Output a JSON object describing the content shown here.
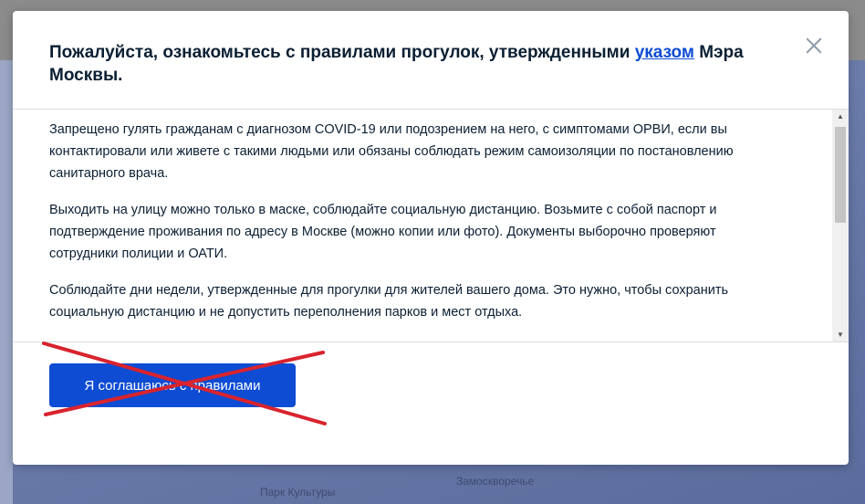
{
  "modal": {
    "title_before": "Пожалуйста, ознакомьтесь с правилами прогулок, утвержденными ",
    "title_link": "указом",
    "title_after": " Мэра Москвы.",
    "paragraphs": [
      "Запрещено гулять гражданам с диагнозом COVID-19 или подозрением на него, с симптомами ОРВИ, если вы контактировали или живете с такими людьми или обязаны соблюдать режим самоизоляции по постановлению санитарного врача.",
      "Выходить на улицу можно только в маске, соблюдайте социальную дистанцию. Возьмите с собой паспорт и подтверждение проживания по адресу в Москве (можно копии или фото). Документы выборочно проверяют сотрудники полиции и ОАТИ.",
      "Соблюдайте дни недели, утвержденные для прогулки для жителей вашего дома. Это нужно, чтобы сохранить социальную дистанцию и не допустить переполнения парков и мест отдыха."
    ],
    "agree_button": "Я соглашаюсь с правилами"
  },
  "background": {
    "map_label_1": "Замоскворечье",
    "map_label_2": "Парк Культуры"
  },
  "colors": {
    "accent": "#0d4cd3",
    "cross": "#d9232e",
    "text": "#0b1f33"
  },
  "icons": {
    "close": "close-icon",
    "scroll_up": "chevron-up-icon",
    "scroll_down": "chevron-down-icon"
  }
}
